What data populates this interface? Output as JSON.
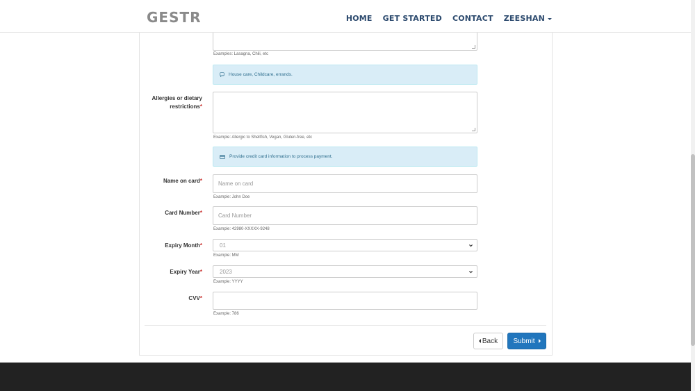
{
  "navbar": {
    "brand": "GESTR",
    "links": [
      "HOME",
      "GET STARTED",
      "CONTACT",
      "ZEESHAN"
    ]
  },
  "form": {
    "favorite_meals_help": "Examples: Lasagna, Chili, etc",
    "services_alert": "House care, Childcare, errands.",
    "allergies_label": "Allergies or dietary restrictions",
    "allergies_help": "Example: Allergic to Shellfish, Vegan, Gluten-free, etc",
    "payment_alert": "Provide credit card information to process payment.",
    "name_label": "Name on card",
    "name_placeholder": "Name on card",
    "name_help": "Example: John Doe",
    "card_label": "Card Number",
    "card_placeholder": "Card Number",
    "card_help": "Example: 42980-XXXXX-9248",
    "month_label": "Expiry Month",
    "month_value": "01",
    "month_help": "Example: MM",
    "year_label": "Expiry Year",
    "year_value": "2023",
    "year_help": "Example: YYYY",
    "cvv_label": "CVV",
    "cvv_help": "Example: 786",
    "required_mark": "*"
  },
  "actions": {
    "back_label": "Back",
    "submit_label": "Submit"
  },
  "colors": {
    "primary": "#2176bd",
    "alert_bg": "#d9edf7",
    "required": "#c9302c",
    "footer": "#222222"
  }
}
